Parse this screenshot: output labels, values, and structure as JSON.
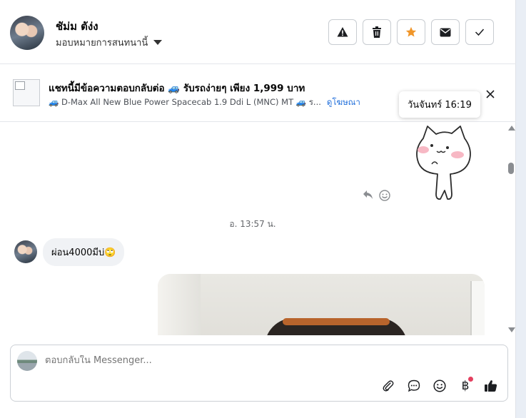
{
  "header": {
    "name": "ชัม่ม ตัง่ง",
    "assign_label": "มอบหมายการสนทนานี้",
    "actions": [
      "report-icon",
      "trash-icon",
      "star-icon",
      "mail-icon",
      "check-icon"
    ],
    "star_color": "#f0962a"
  },
  "ad": {
    "title": "แชทนี้มีข้อความตอบกลับต่อ 🚙 รับรถง่ายๆ เพียง 1,999 บาท",
    "subtitle": "🚙 D-Max All New Blue Power Spacecab 1.9 Ddi L (MNC) MT 🚙 ร...",
    "link": "ดูโฆษณา"
  },
  "tooltip": "วันจันทร์ 16:19",
  "thread": {
    "timestamp": "อ. 13:57 น.",
    "incoming_message": "ผ่อน4000มีบ่🙄"
  },
  "composer": {
    "placeholder": "ตอบกลับใน Messenger...",
    "currency_glyph": "฿"
  }
}
